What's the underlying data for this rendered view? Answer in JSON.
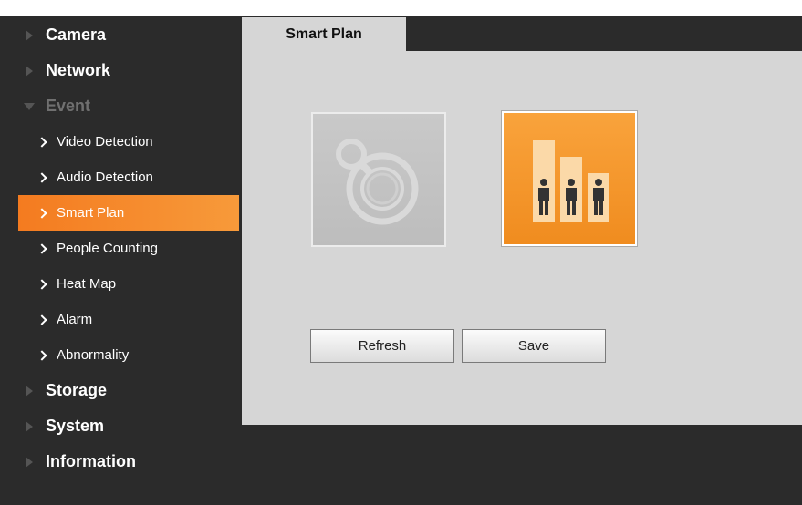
{
  "sidebar": {
    "categories_top": [
      {
        "label": "Camera"
      },
      {
        "label": "Network"
      }
    ],
    "event": {
      "label": "Event",
      "items": [
        {
          "label": "Video Detection"
        },
        {
          "label": "Audio Detection"
        },
        {
          "label": "Smart Plan"
        },
        {
          "label": "People Counting"
        },
        {
          "label": "Heat Map"
        },
        {
          "label": "Alarm"
        },
        {
          "label": "Abnormality"
        }
      ],
      "active_item": "Smart Plan"
    },
    "categories_bottom": [
      {
        "label": "Storage"
      },
      {
        "label": "System"
      },
      {
        "label": "Information"
      }
    ]
  },
  "main": {
    "tab_label": "Smart Plan",
    "cards": [
      {
        "icon": "audio-detection-icon",
        "selected": false
      },
      {
        "icon": "people-counting-icon",
        "selected": true
      }
    ],
    "buttons": {
      "refresh_label": "Refresh",
      "save_label": "Save"
    }
  },
  "colors": {
    "accent": "#f47b20",
    "background": "#2b2b2b",
    "panel": "#d6d6d6"
  }
}
